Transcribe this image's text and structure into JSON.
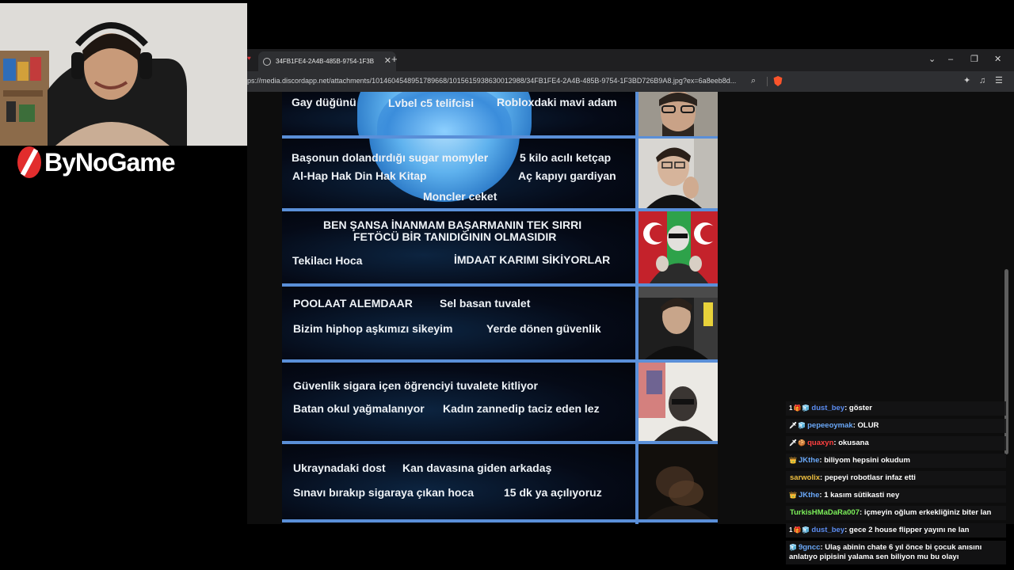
{
  "browser": {
    "tab_title": "34FB1FE4-2A4B-485B-9754-1F3B",
    "tab_close": "✕",
    "new_tab": "+",
    "url": "ps://media.discordapp.net/attachments/1014604548951789668/1015615938630012988/34FB1FE4-2A4B-485B-9754-1F3BD726B9A8.jpg?ex=6a8eeb8d...",
    "window_controls": {
      "dropdown": "⌄",
      "minimize": "–",
      "restore": "❐",
      "close": "✕"
    }
  },
  "image": {
    "rows": [
      {
        "labels": [
          "Gay düğünü",
          "Lvbel c5 telifcisi",
          "Robloxdaki mavi adam"
        ]
      },
      {
        "labels": [
          "Başonun dolandırdığı sugar momyler",
          "5 kilo acılı ketçap",
          "Al-Hap Hak Din Hak Kitap",
          "Aç kapıyı gardiyan",
          "Moncler ceket"
        ]
      },
      {
        "labels": [
          "BEN ŞANSA İNANMAM BAŞARMANIN TEK SIRRI",
          "FETÖCÜ BİR TANIDIĞININ OLMASIDIR",
          "Tekilacı Hoca",
          "İMDAAT KARIMI SİKİYORLAR"
        ]
      },
      {
        "labels": [
          "POOLAAT ALEMDAAR",
          "Sel basan tuvalet",
          "Bizim hiphop aşkımızı sikeyim",
          "Yerde dönen güvenlik"
        ]
      },
      {
        "labels": [
          "Güvenlik sigara içen öğrenciyi tuvalete kitliyor",
          "Batan okul yağmalanıyor",
          "Kadın zannedip taciz eden lez"
        ]
      },
      {
        "labels": [
          "Ukraynadaki dost",
          "Kan davasına giden arkadaş",
          "Sınavı bırakıp sigaraya çıkan hoca",
          "15 dk ya açılıyoruz"
        ]
      }
    ]
  },
  "logo": {
    "text": "ByNoGame"
  },
  "chat": {
    "messages": [
      {
        "badges": [
          "1",
          "🎁",
          "🧊"
        ],
        "user": "dust_bey",
        "user_color": "#5b8cf0",
        "text": "göster"
      },
      {
        "badges": [
          "🗡",
          "🧊"
        ],
        "user": "pepeeoymak",
        "user_color": "#6aa8f8",
        "text": "OLUR"
      },
      {
        "badges": [
          "🗡",
          "🍪"
        ],
        "user": "quaxyn",
        "user_color": "#ff4040",
        "text": "okusana"
      },
      {
        "badges": [
          "👑"
        ],
        "user": "JKthe",
        "user_color": "#6aa8f8",
        "text": "biliyom hepsini okudum"
      },
      {
        "badges": [],
        "user": "sarwolix",
        "user_color": "#f0c040",
        "text": "pepeyi robotlasr infaz etti"
      },
      {
        "badges": [
          "👑"
        ],
        "user": "JKthe",
        "user_color": "#6aa8f8",
        "text": "1 kasım sütikasti ney"
      },
      {
        "badges": [],
        "user": "TurkisHMaDaRa007",
        "user_color": "#7cf05a",
        "text": "içmeyin oğlum erkekliğiniz biter lan"
      },
      {
        "badges": [
          "1",
          "🎁",
          "🧊"
        ],
        "user": "dust_bey",
        "user_color": "#5b8cf0",
        "text": "gece 2 house flipper yayını ne lan"
      },
      {
        "badges": [
          "🧊"
        ],
        "user": "9gncc",
        "user_color": "#6aa8f8",
        "text": "Ulaş abinin chate 6 yıl önce bi çocuk anısını anlatıyo pipisini yalama sen biliyon mu bu olayı"
      }
    ]
  }
}
